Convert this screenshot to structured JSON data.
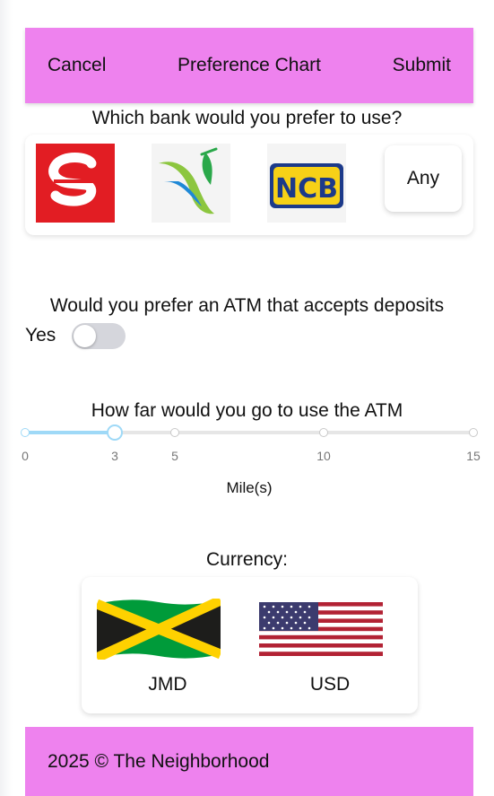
{
  "header": {
    "cancel": "Cancel",
    "title": "Preference Chart",
    "submit": "Submit"
  },
  "bank_question": "Which bank would you prefer to use?",
  "banks": [
    {
      "name": "scotiabank-logo"
    },
    {
      "name": "jn-bank-logo"
    },
    {
      "name": "ncb-logo",
      "text": "NCB"
    },
    {
      "name": "any-option",
      "label": "Any"
    }
  ],
  "atm_question": "Would you prefer an ATM that accepts deposits",
  "atm_toggle": {
    "label": "Yes",
    "on": false
  },
  "distance_question": "How far would you go to use the ATM",
  "distance_slider": {
    "min": 0,
    "max": 15,
    "value": 3,
    "marks": [
      "0",
      "3",
      "5",
      "10",
      "15"
    ],
    "unit": "Mile(s)"
  },
  "currency_question": "Currency:",
  "currencies": [
    {
      "code": "JMD"
    },
    {
      "code": "USD"
    }
  ],
  "footer": {
    "text": "2025 © The Neighborhood"
  },
  "colors": {
    "header_bg": "#ee82ee",
    "slider_accent": "#9fd9f7"
  }
}
